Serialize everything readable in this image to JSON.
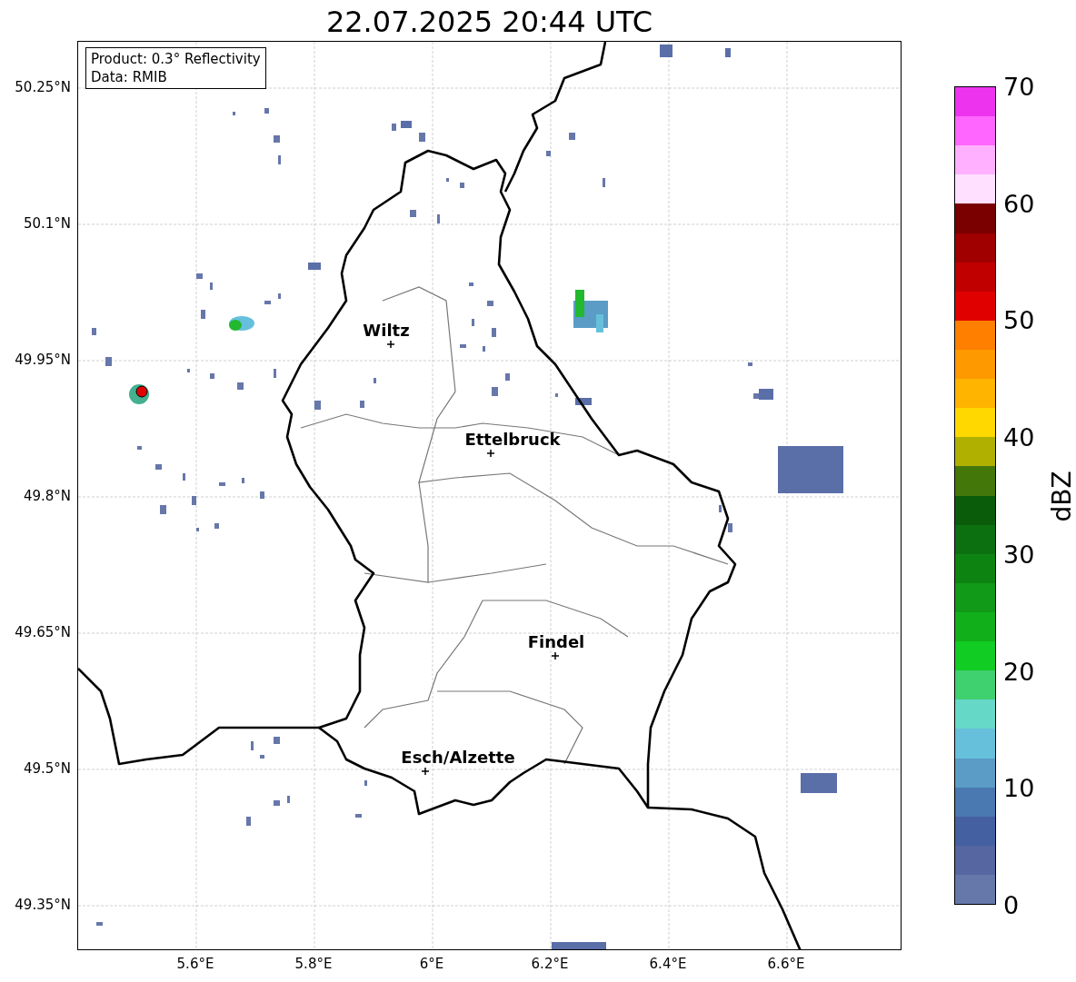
{
  "title": "22.07.2025 20:44 UTC",
  "info_box": {
    "lines": [
      "Product: 0.3° Reflectivity",
      "Data: RMIB"
    ]
  },
  "map": {
    "lat_labels": [
      "50.25°N",
      "50.1°N",
      "49.95°N",
      "49.8°N",
      "49.65°N",
      "49.5°N",
      "49.35°N"
    ],
    "lon_labels": [
      "5.6°E",
      "5.8°E",
      "6°E",
      "6.2°E",
      "6.4°E",
      "6.6°E"
    ],
    "places": [
      {
        "name": "Wiltz"
      },
      {
        "name": "Ettelbruck"
      },
      {
        "name": "Findel"
      },
      {
        "name": "Esch/Alzette"
      }
    ]
  },
  "colorbar": {
    "label": "dBZ",
    "ticks": [
      "70",
      "60",
      "50",
      "40",
      "30",
      "20",
      "10",
      "0"
    ],
    "bands": [
      {
        "color": "#ee33ee"
      },
      {
        "color": "#ff66ff"
      },
      {
        "color": "#ffb0ff"
      },
      {
        "color": "#ffe0ff"
      },
      {
        "color": "#7a0000"
      },
      {
        "color": "#a00000"
      },
      {
        "color": "#c00000"
      },
      {
        "color": "#e00000"
      },
      {
        "color": "#ff7f00"
      },
      {
        "color": "#ff9900"
      },
      {
        "color": "#ffb400"
      },
      {
        "color": "#ffd800"
      },
      {
        "color": "#b0b000"
      },
      {
        "color": "#44770a"
      },
      {
        "color": "#0a5c0a"
      },
      {
        "color": "#0c7010"
      },
      {
        "color": "#0d8412"
      },
      {
        "color": "#119a18"
      },
      {
        "color": "#11b01a"
      },
      {
        "color": "#11cc22"
      },
      {
        "color": "#3fd070"
      },
      {
        "color": "#66d8c8"
      },
      {
        "color": "#66c0dc"
      },
      {
        "color": "#5a9cc6"
      },
      {
        "color": "#4a78b0"
      },
      {
        "color": "#4460a0"
      },
      {
        "color": "#5566a0"
      },
      {
        "color": "#6677aa"
      }
    ]
  }
}
